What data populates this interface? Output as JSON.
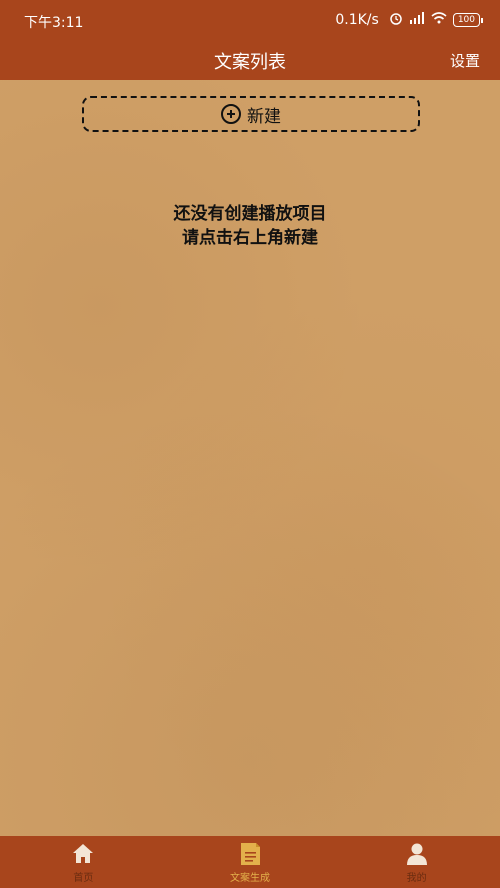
{
  "status_bar": {
    "time": "下午3:11",
    "network_speed": "0.1K/s",
    "battery": "100"
  },
  "header": {
    "title": "文案列表",
    "settings_label": "设置"
  },
  "main": {
    "new_button_label": "新建",
    "empty_line1": "还没有创建播放项目",
    "empty_line2": "请点击右上角新建"
  },
  "bottom_nav": {
    "items": [
      {
        "label": "首页",
        "icon": "home-icon",
        "active": false
      },
      {
        "label": "文案生成",
        "icon": "document-icon",
        "active": true
      },
      {
        "label": "我的",
        "icon": "user-icon",
        "active": false
      }
    ]
  },
  "colors": {
    "bar": "#a8451c",
    "paper": "#cf9f66",
    "active_nav": "#e3b04b"
  }
}
